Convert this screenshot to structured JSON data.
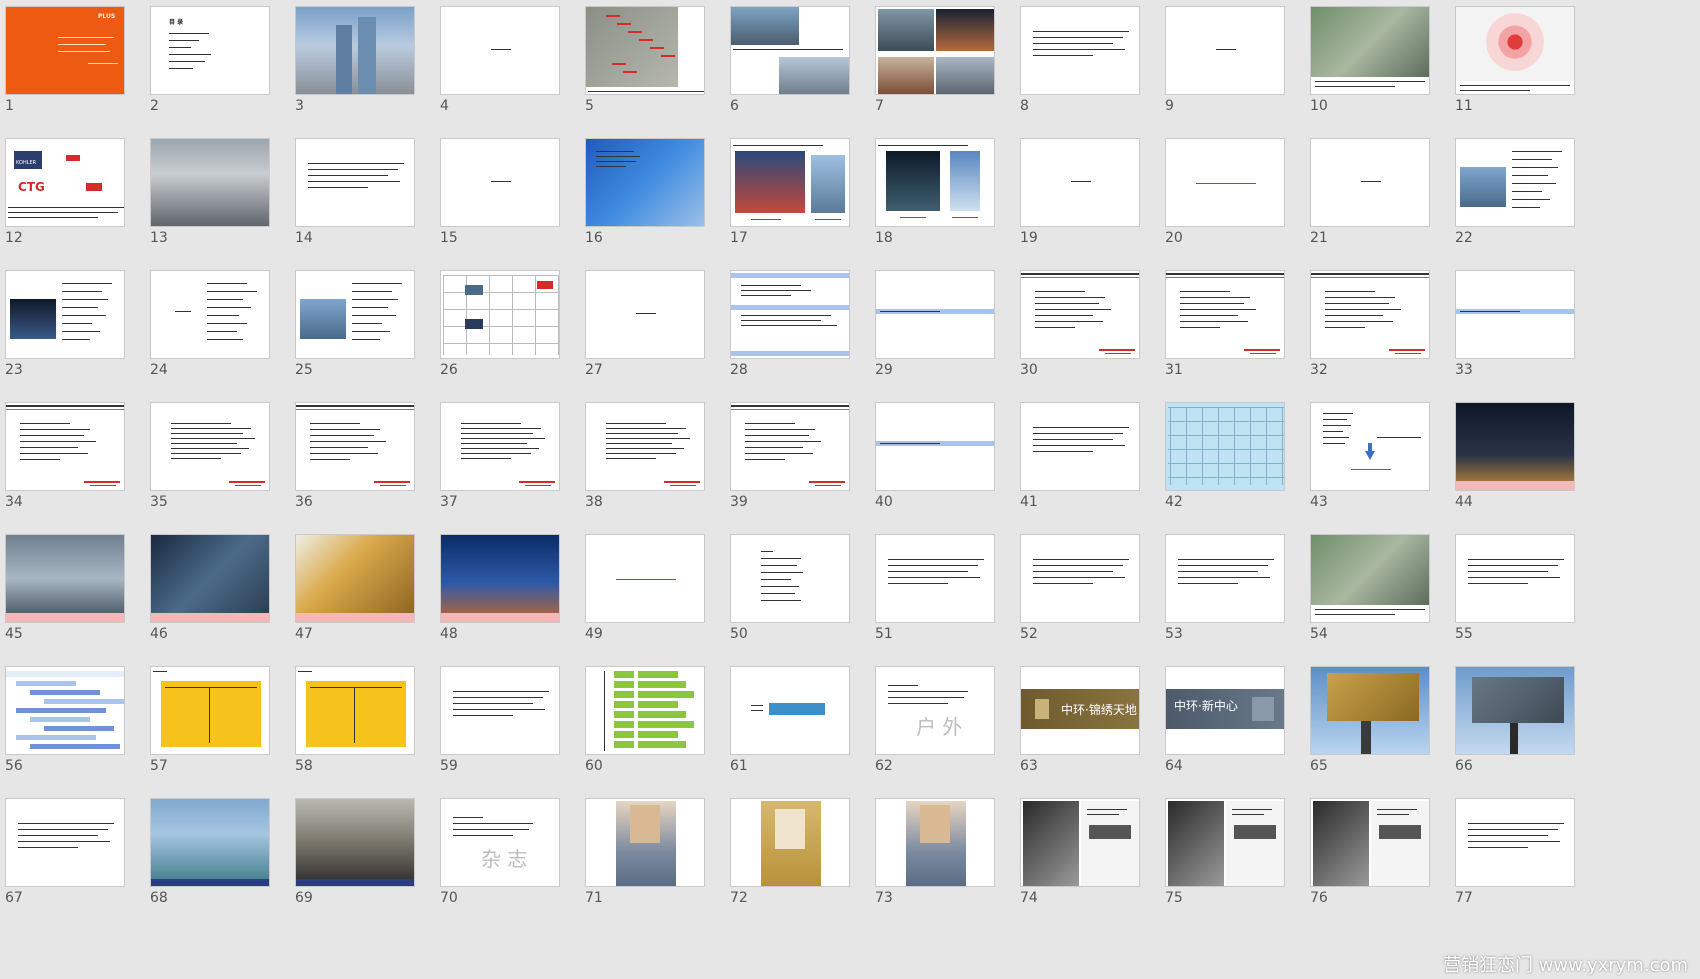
{
  "slides": [
    {
      "n": "1",
      "type": "cover",
      "title": "PLUS"
    },
    {
      "n": "2",
      "type": "contents",
      "title": "目 录"
    },
    {
      "n": "3",
      "type": "photo",
      "scene": "towers"
    },
    {
      "n": "4",
      "type": "center-text"
    },
    {
      "n": "5",
      "type": "map-annotated"
    },
    {
      "n": "6",
      "type": "photo-collage"
    },
    {
      "n": "7",
      "type": "photo-grid"
    },
    {
      "n": "8",
      "type": "text-lines"
    },
    {
      "n": "9",
      "type": "center-text"
    },
    {
      "n": "10",
      "type": "aerial"
    },
    {
      "n": "11",
      "type": "radial-map"
    },
    {
      "n": "12",
      "type": "logos",
      "logo1": "KOHLER",
      "logo2": "CTG"
    },
    {
      "n": "13",
      "type": "photo",
      "scene": "street"
    },
    {
      "n": "14",
      "type": "text-lines"
    },
    {
      "n": "15",
      "type": "center-text"
    },
    {
      "n": "16",
      "type": "photo",
      "scene": "bluetowers"
    },
    {
      "n": "17",
      "type": "two-photos"
    },
    {
      "n": "18",
      "type": "two-photos-dark"
    },
    {
      "n": "19",
      "type": "center-text"
    },
    {
      "n": "20",
      "type": "red-center-text"
    },
    {
      "n": "21",
      "type": "center-text"
    },
    {
      "n": "22",
      "type": "photo-list"
    },
    {
      "n": "23",
      "type": "photo-list-dark"
    },
    {
      "n": "24",
      "type": "list"
    },
    {
      "n": "25",
      "type": "photo-list"
    },
    {
      "n": "26",
      "type": "table"
    },
    {
      "n": "27",
      "type": "center-text"
    },
    {
      "n": "28",
      "type": "bars"
    },
    {
      "n": "29",
      "type": "blue-band"
    },
    {
      "n": "30",
      "type": "header-text"
    },
    {
      "n": "31",
      "type": "header-text"
    },
    {
      "n": "32",
      "type": "header-text"
    },
    {
      "n": "33",
      "type": "blue-band"
    },
    {
      "n": "34",
      "type": "header-text"
    },
    {
      "n": "35",
      "type": "text-block"
    },
    {
      "n": "36",
      "type": "header-text"
    },
    {
      "n": "37",
      "type": "text-block"
    },
    {
      "n": "38",
      "type": "text-block"
    },
    {
      "n": "39",
      "type": "header-text"
    },
    {
      "n": "40",
      "type": "blue-band"
    },
    {
      "n": "41",
      "type": "text-lines"
    },
    {
      "n": "42",
      "type": "cyan-table"
    },
    {
      "n": "43",
      "type": "diagram-arrow"
    },
    {
      "n": "44",
      "type": "photo",
      "scene": "night"
    },
    {
      "n": "45",
      "type": "photo",
      "scene": "business"
    },
    {
      "n": "46",
      "type": "photo",
      "scene": "citytop"
    },
    {
      "n": "47",
      "type": "photo",
      "scene": "coins"
    },
    {
      "n": "48",
      "type": "photo",
      "scene": "nightcity"
    },
    {
      "n": "49",
      "type": "red-center-text"
    },
    {
      "n": "50",
      "type": "list-center"
    },
    {
      "n": "51",
      "type": "text-lines"
    },
    {
      "n": "52",
      "type": "text-lines"
    },
    {
      "n": "53",
      "type": "text-lines"
    },
    {
      "n": "54",
      "type": "aerial"
    },
    {
      "n": "55",
      "type": "text-lines"
    },
    {
      "n": "56",
      "type": "gantt"
    },
    {
      "n": "57",
      "type": "yellow-chart"
    },
    {
      "n": "58",
      "type": "yellow-chart"
    },
    {
      "n": "59",
      "type": "text-lines"
    },
    {
      "n": "60",
      "type": "green-chart"
    },
    {
      "n": "61",
      "type": "blue-banner"
    },
    {
      "n": "62",
      "type": "text-outdoor",
      "big": "户   外"
    },
    {
      "n": "63",
      "type": "brown-banner",
      "label": "中环·锦绣天地"
    },
    {
      "n": "64",
      "type": "gray-banner",
      "label": "中环·新中心"
    },
    {
      "n": "65",
      "type": "billboard-gold"
    },
    {
      "n": "66",
      "type": "billboard-gray"
    },
    {
      "n": "67",
      "type": "text-lines"
    },
    {
      "n": "68",
      "type": "photo",
      "scene": "building-ad"
    },
    {
      "n": "69",
      "type": "photo",
      "scene": "dusk"
    },
    {
      "n": "70",
      "type": "text-outdoor",
      "big": "杂   志"
    },
    {
      "n": "71",
      "type": "magazine"
    },
    {
      "n": "72",
      "type": "magazine-gold"
    },
    {
      "n": "73",
      "type": "magazine"
    },
    {
      "n": "74",
      "type": "spread"
    },
    {
      "n": "75",
      "type": "spread"
    },
    {
      "n": "76",
      "type": "spread"
    },
    {
      "n": "77",
      "type": "text-lines"
    }
  ],
  "watermark": "营销狂恋门 www.yxrym.com",
  "colors": {
    "background": "#e6e6e6",
    "accent_red": "#d62b2b",
    "cover_orange": "#ee5a12",
    "band_blue": "#a9c3ea",
    "yellow": "#f6c21c",
    "green": "#8cc63f"
  }
}
